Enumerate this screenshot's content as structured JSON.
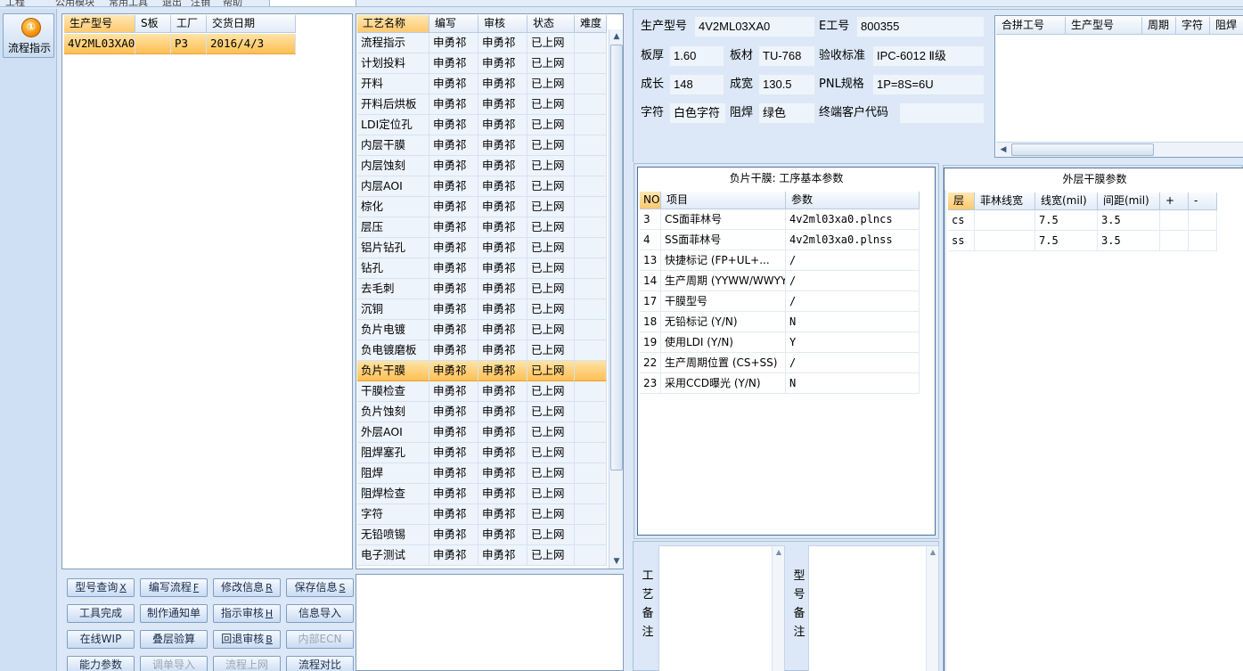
{
  "menubar": {
    "items": [
      "工程",
      "公用模块",
      "常用工具",
      "退出",
      "注销",
      "帮助"
    ]
  },
  "left_strip": {
    "flow_button_label": "流程指示",
    "flow_icon_glyph": "①"
  },
  "orders_table": {
    "headers": [
      "生产型号",
      "S板",
      "工厂",
      "交货日期"
    ],
    "rows": [
      {
        "model": "4V2ML03XA0",
        "s_board": "",
        "factory": "P3",
        "date": "2016/4/3"
      }
    ]
  },
  "process_table": {
    "headers": [
      "工艺名称",
      "编写",
      "审核",
      "状态",
      "难度"
    ],
    "selected_index": 17,
    "rows": [
      {
        "name": "流程指示",
        "writer": "申勇祁",
        "reviewer": "申勇祁",
        "status": "已上网",
        "difficulty": ""
      },
      {
        "name": "计划投料",
        "writer": "申勇祁",
        "reviewer": "申勇祁",
        "status": "已上网",
        "difficulty": ""
      },
      {
        "name": "开料",
        "writer": "申勇祁",
        "reviewer": "申勇祁",
        "status": "已上网",
        "difficulty": ""
      },
      {
        "name": "开料后烘板",
        "writer": "申勇祁",
        "reviewer": "申勇祁",
        "status": "已上网",
        "difficulty": ""
      },
      {
        "name": "LDI定位孔",
        "writer": "申勇祁",
        "reviewer": "申勇祁",
        "status": "已上网",
        "difficulty": ""
      },
      {
        "name": "内层干膜",
        "writer": "申勇祁",
        "reviewer": "申勇祁",
        "status": "已上网",
        "difficulty": ""
      },
      {
        "name": "内层蚀刻",
        "writer": "申勇祁",
        "reviewer": "申勇祁",
        "status": "已上网",
        "difficulty": ""
      },
      {
        "name": "内层AOI",
        "writer": "申勇祁",
        "reviewer": "申勇祁",
        "status": "已上网",
        "difficulty": ""
      },
      {
        "name": "棕化",
        "writer": "申勇祁",
        "reviewer": "申勇祁",
        "status": "已上网",
        "difficulty": ""
      },
      {
        "name": "层压",
        "writer": "申勇祁",
        "reviewer": "申勇祁",
        "status": "已上网",
        "difficulty": ""
      },
      {
        "name": "铝片钻孔",
        "writer": "申勇祁",
        "reviewer": "申勇祁",
        "status": "已上网",
        "difficulty": ""
      },
      {
        "name": "钻孔",
        "writer": "申勇祁",
        "reviewer": "申勇祁",
        "status": "已上网",
        "difficulty": ""
      },
      {
        "name": "去毛刺",
        "writer": "申勇祁",
        "reviewer": "申勇祁",
        "status": "已上网",
        "difficulty": ""
      },
      {
        "name": "沉铜",
        "writer": "申勇祁",
        "reviewer": "申勇祁",
        "status": "已上网",
        "difficulty": ""
      },
      {
        "name": "负片电镀",
        "writer": "申勇祁",
        "reviewer": "申勇祁",
        "status": "已上网",
        "difficulty": ""
      },
      {
        "name": "负电镀磨板",
        "writer": "申勇祁",
        "reviewer": "申勇祁",
        "status": "已上网",
        "difficulty": ""
      },
      {
        "name": "负片干膜",
        "writer": "申勇祁",
        "reviewer": "申勇祁",
        "status": "已上网",
        "difficulty": ""
      },
      {
        "name": "负片干膜",
        "writer": "申勇祁",
        "reviewer": "申勇祁",
        "status": "已上网",
        "difficulty": ""
      },
      {
        "name": "干膜检查",
        "writer": "申勇祁",
        "reviewer": "申勇祁",
        "status": "已上网",
        "difficulty": ""
      },
      {
        "name": "负片蚀刻",
        "writer": "申勇祁",
        "reviewer": "申勇祁",
        "status": "已上网",
        "difficulty": ""
      },
      {
        "name": "外层AOI",
        "writer": "申勇祁",
        "reviewer": "申勇祁",
        "status": "已上网",
        "difficulty": ""
      },
      {
        "name": "阻焊塞孔",
        "writer": "申勇祁",
        "reviewer": "申勇祁",
        "status": "已上网",
        "difficulty": ""
      },
      {
        "name": "阻焊",
        "writer": "申勇祁",
        "reviewer": "申勇祁",
        "status": "已上网",
        "difficulty": ""
      },
      {
        "name": "阻焊检查",
        "writer": "申勇祁",
        "reviewer": "申勇祁",
        "status": "已上网",
        "difficulty": ""
      },
      {
        "name": "字符",
        "writer": "申勇祁",
        "reviewer": "申勇祁",
        "status": "已上网",
        "difficulty": ""
      },
      {
        "name": "无铅喷锡",
        "writer": "申勇祁",
        "reviewer": "申勇祁",
        "status": "已上网",
        "difficulty": ""
      },
      {
        "name": "电子测试",
        "writer": "申勇祁",
        "reviewer": "申勇祁",
        "status": "已上网",
        "difficulty": ""
      }
    ]
  },
  "buttons": {
    "row1": [
      {
        "label": "型号查询",
        "key": "X",
        "disabled": false
      },
      {
        "label": "编写流程",
        "key": "F",
        "disabled": false
      },
      {
        "label": "修改信息",
        "key": "R",
        "disabled": false
      },
      {
        "label": "保存信息",
        "key": "S",
        "disabled": false
      }
    ],
    "row2": [
      {
        "label": "工具完成",
        "key": "",
        "disabled": false
      },
      {
        "label": "制作通知单",
        "key": "",
        "disabled": false
      },
      {
        "label": "指示审核",
        "key": "H",
        "disabled": false
      },
      {
        "label": "信息导入",
        "key": "",
        "disabled": false
      }
    ],
    "row3": [
      {
        "label": "在线WIP",
        "key": "",
        "disabled": false
      },
      {
        "label": "叠层验算",
        "key": "",
        "disabled": false
      },
      {
        "label": "回退审核",
        "key": "B",
        "disabled": false
      },
      {
        "label": "内部ECN",
        "key": "",
        "disabled": true
      }
    ],
    "row4": [
      {
        "label": "能力参数",
        "key": "",
        "disabled": false
      },
      {
        "label": "调单导入",
        "key": "",
        "disabled": true
      },
      {
        "label": "流程上网",
        "key": "",
        "disabled": true
      },
      {
        "label": "流程对比",
        "key": "",
        "disabled": false
      }
    ]
  },
  "info": {
    "model_label": "生产型号",
    "model_value": "4V2ML03XA0",
    "ework_label": "E工号",
    "ework_value": "800355",
    "thickness_label": "板厚",
    "thickness_value": "1.60",
    "material_label": "板材",
    "material_value": "TU-768",
    "standard_label": "验收标准",
    "standard_value": "IPC-6012 Ⅱ级",
    "length_label": "成长",
    "length_value": "148",
    "width_label": "成宽",
    "width_value": "130.5",
    "pnl_label": "PNL规格",
    "pnl_value": "1P=8S=6U",
    "char_label": "字符",
    "char_value": "白色字符",
    "mask_label": "阻焊",
    "mask_value": "绿色",
    "customer_label": "终端客户代码",
    "customer_value": ""
  },
  "merge_table": {
    "headers": [
      "合拼工号",
      "生产型号",
      "周期",
      "字符",
      "阻焊"
    ]
  },
  "neg_film": {
    "title": "负片干膜: 工序基本参数",
    "headers": [
      "NO",
      "项目",
      "参数"
    ],
    "rows": [
      {
        "no": "3",
        "item": "CS面菲林号",
        "param": "4v2ml03xa0.plncs"
      },
      {
        "no": "4",
        "item": "SS面菲林号",
        "param": "4v2ml03xa0.plnss"
      },
      {
        "no": "13",
        "item": "快捷标记 (FP+UL+...",
        "param": "/"
      },
      {
        "no": "14",
        "item": "生产周期 (YYWW/WWYY)",
        "param": "/"
      },
      {
        "no": "17",
        "item": "干膜型号",
        "param": "/"
      },
      {
        "no": "18",
        "item": "无铅标记 (Y/N)",
        "param": "N"
      },
      {
        "no": "19",
        "item": "使用LDI (Y/N)",
        "param": "Y"
      },
      {
        "no": "22",
        "item": "生产周期位置 (CS+SS)",
        "param": "/"
      },
      {
        "no": "23",
        "item": "采用CCD曝光 (Y/N)",
        "param": "N"
      }
    ]
  },
  "outer_film": {
    "title": "外层干膜参数",
    "headers": [
      "层",
      "菲林线宽",
      "线宽(mil)",
      "间距(mil)",
      "+",
      "-"
    ],
    "rows": [
      {
        "layer": "cs",
        "film_width": "",
        "width": "7.5",
        "spacing": "3.5"
      },
      {
        "layer": "ss",
        "film_width": "",
        "width": "7.5",
        "spacing": "3.5"
      }
    ]
  },
  "remarks": {
    "process_label": "工艺备注",
    "model_label": "型号备注"
  }
}
